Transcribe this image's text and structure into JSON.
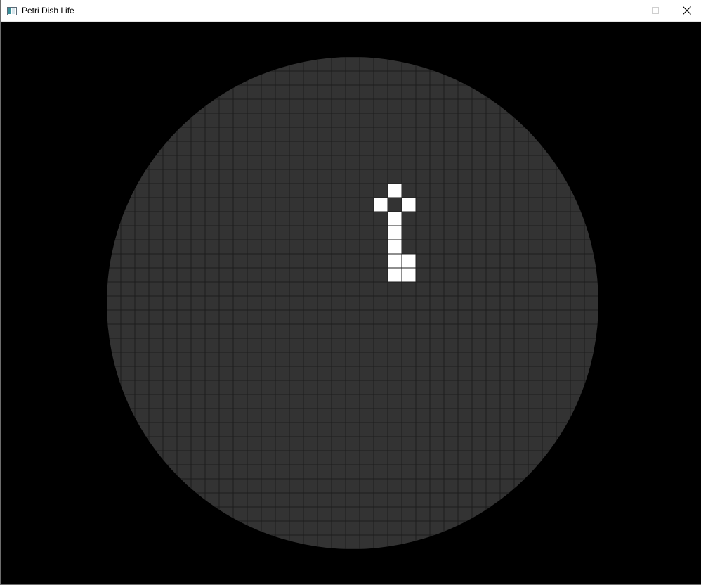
{
  "window": {
    "title": "Petri Dish Life",
    "icon": "app-window-icon",
    "controls": [
      "minimize-icon",
      "maximize-icon",
      "close-icon"
    ]
  },
  "dish": {
    "grid_columns": 35,
    "grid_rows": 35,
    "colors": {
      "background": "#000000",
      "dish": "#333333",
      "grid_line": "#1c1c1c",
      "live_cell": "#ffffff"
    },
    "live_cells": [
      {
        "col": 20,
        "row": 9
      },
      {
        "col": 19,
        "row": 10
      },
      {
        "col": 21,
        "row": 10
      },
      {
        "col": 20,
        "row": 11
      },
      {
        "col": 20,
        "row": 12
      },
      {
        "col": 20,
        "row": 13
      },
      {
        "col": 20,
        "row": 14
      },
      {
        "col": 21,
        "row": 14
      },
      {
        "col": 20,
        "row": 15
      },
      {
        "col": 21,
        "row": 15
      }
    ]
  }
}
